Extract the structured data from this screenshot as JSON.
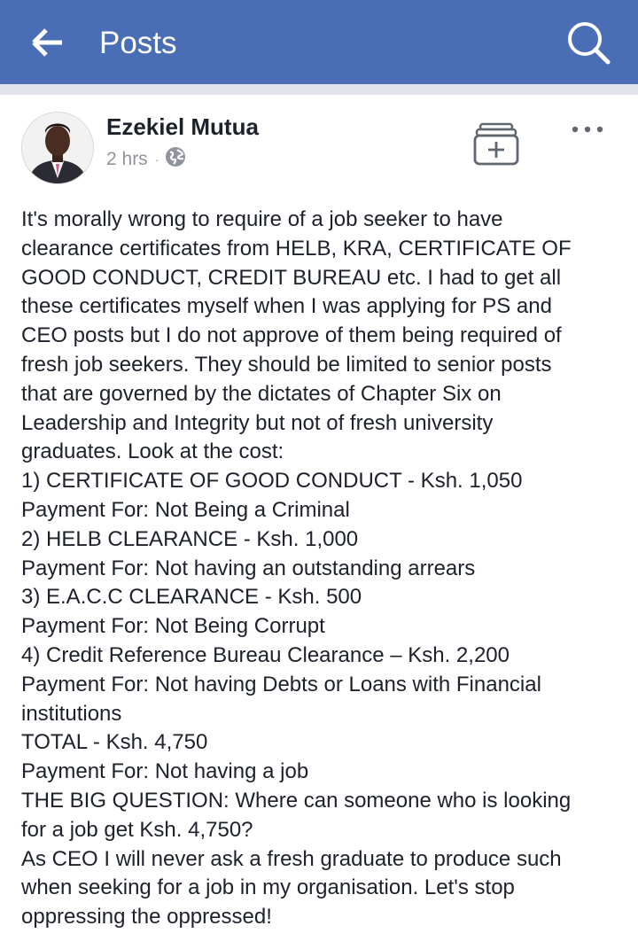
{
  "header": {
    "title": "Posts",
    "back_icon": "back-arrow-icon",
    "search_icon": "search-icon",
    "background_color": "#4a6eb5"
  },
  "post": {
    "author": "Ezekiel Mutua",
    "time": "2 hrs",
    "separator": "·",
    "privacy_icon": "globe-icon",
    "save_icon": "save-to-collection-icon",
    "more_icon": "more-options-icon",
    "body": "It's morally wrong to require of a job seeker to have\nclearance certificates from HELB, KRA, CERTIFICATE OF\nGOOD CONDUCT, CREDIT BUREAU etc. I had to get all\nthese certificates myself when I was applying for PS and\nCEO posts but I do not approve of them being required of\nfresh job seekers. They should be limited to senior posts\nthat are governed by the dictates of Chapter Six on\nLeadership and Integrity but not of fresh university\ngraduates. Look at the cost:\n1) CERTIFICATE OF GOOD CONDUCT - Ksh. 1,050\nPayment For: Not Being a Criminal\n2) HELB CLEARANCE - Ksh. 1,000\nPayment For: Not having an outstanding arrears\n3) E.A.C.C CLEARANCE - Ksh. 500\nPayment For: Not Being Corrupt\n4) Credit Reference Bureau Clearance – Ksh. 2,200\nPayment For: Not having Debts or Loans with Financial\ninstitutions\nTOTAL - Ksh. 4,750\nPayment For: Not having a job\nTHE BIG QUESTION: Where can someone who is looking\nfor a job get Ksh. 4,750?\nAs CEO I will never ask a fresh graduate to produce such\nwhen seeking for a job in my organisation. Let's stop\noppressing the oppressed!"
  }
}
